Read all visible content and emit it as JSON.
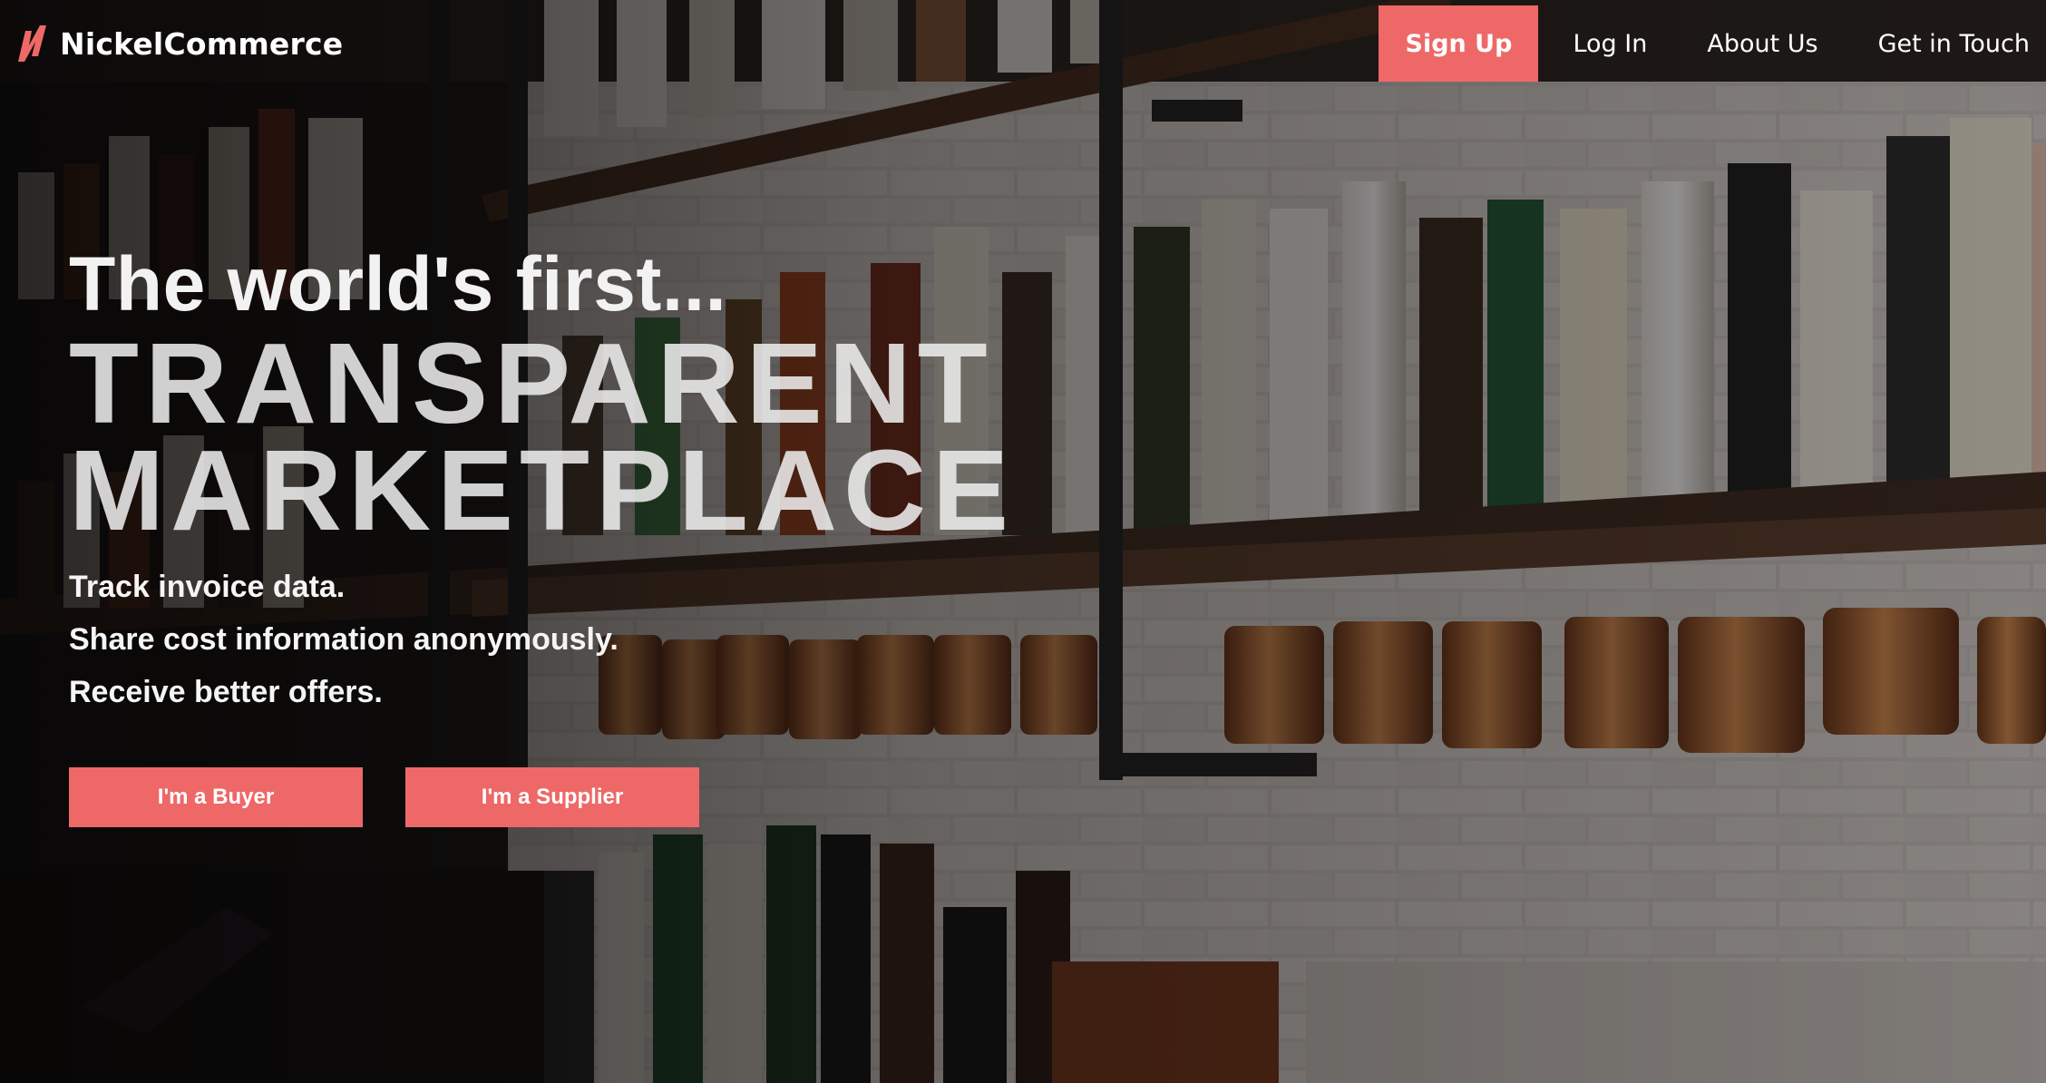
{
  "brand": {
    "name": "NickelCommerce",
    "accent": "#ee6868",
    "logo_icon": "lightning-n-icon"
  },
  "nav": {
    "signup": "Sign Up",
    "login": "Log In",
    "about": "About Us",
    "contact": "Get in Touch"
  },
  "hero": {
    "kicker": "The world's first...",
    "title_line1": "TRANSPARENT",
    "title_line2": "MARKETPLACE",
    "lines": [
      "Track invoice data.",
      "Share cost information anonymously.",
      "Receive better offers."
    ],
    "buyer_button": "I'm a Buyer",
    "supplier_button": "I'm a Supplier"
  },
  "background": {
    "subject": "bar shelves with liquor bottles and copper mugs"
  }
}
